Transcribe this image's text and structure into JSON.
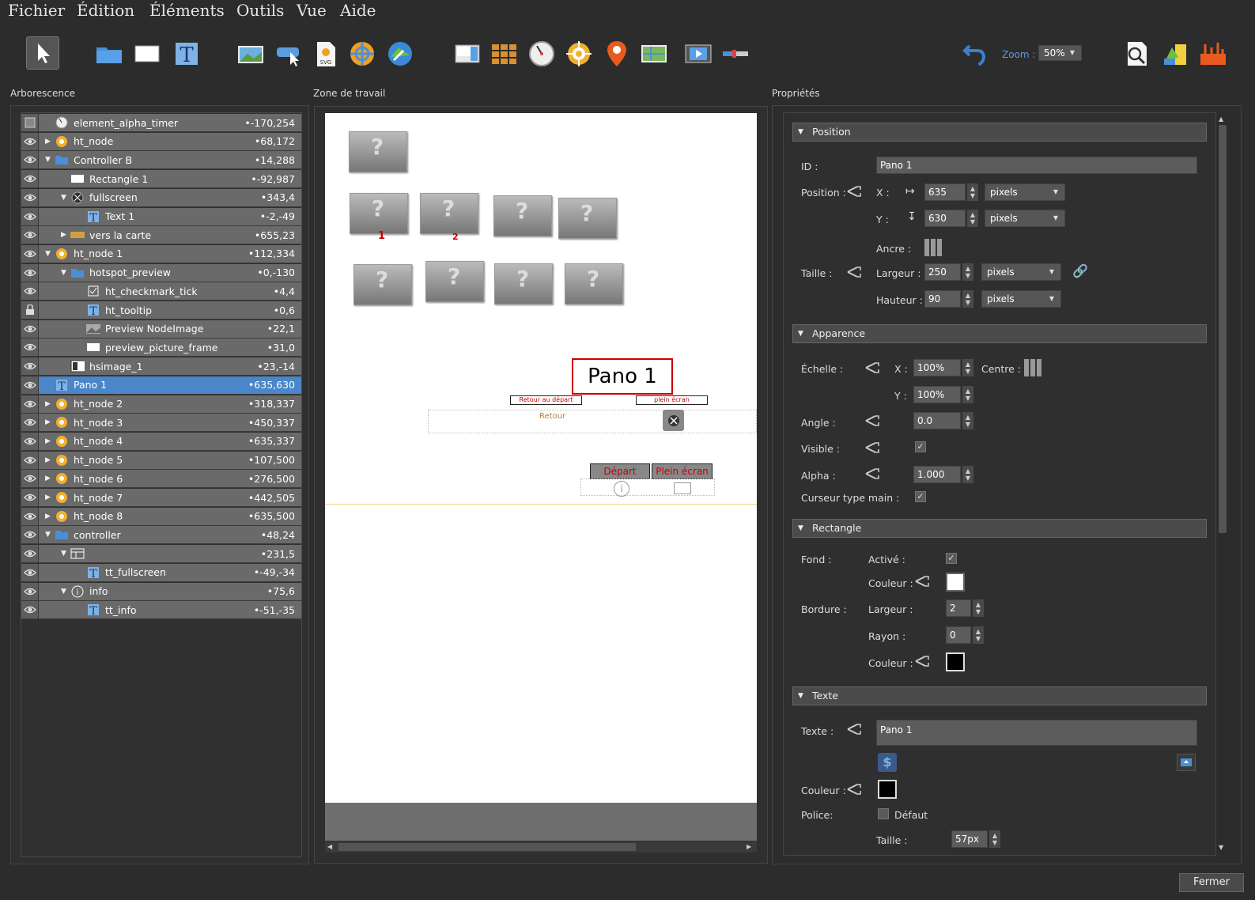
{
  "menu": [
    "Fichier",
    "Édition",
    "Éléments",
    "Outils",
    "Vue",
    "Aide"
  ],
  "toolbar": {
    "zoom_label": "Zoom :",
    "zoom_value": "50%"
  },
  "panels": {
    "tree": "Arborescence",
    "work": "Zone de travail",
    "props": "Propriétés"
  },
  "tree": [
    {
      "label": "element_alpha_timer",
      "val": "•-170,254",
      "indent": 0,
      "arrow": "",
      "icon": "timer-icon",
      "eye": false
    },
    {
      "label": "ht_node",
      "val": "•68,172",
      "indent": 0,
      "arrow": "▶",
      "icon": "node-icon",
      "eye": true
    },
    {
      "label": "Controller B",
      "val": "•14,288",
      "indent": 0,
      "arrow": "▼",
      "icon": "folder-icon",
      "eye": true
    },
    {
      "label": "Rectangle 1",
      "val": "•-92,987",
      "indent": 1,
      "arrow": "",
      "icon": "rectangle-icon",
      "eye": true
    },
    {
      "label": "fullscreen",
      "val": "•343,4",
      "indent": 1,
      "arrow": "▼",
      "icon": "fullscreen-icon",
      "eye": true
    },
    {
      "label": "Text 1",
      "val": "•-2,-49",
      "indent": 2,
      "arrow": "",
      "icon": "text-icon",
      "eye": true
    },
    {
      "label": "vers la carte",
      "val": "•655,23",
      "indent": 1,
      "arrow": "▶",
      "icon": "button-icon",
      "eye": true
    },
    {
      "label": "ht_node 1",
      "val": "•112,334",
      "indent": 0,
      "arrow": "▼",
      "icon": "node-icon",
      "eye": true
    },
    {
      "label": "hotspot_preview",
      "val": "•0,-130",
      "indent": 1,
      "arrow": "▼",
      "icon": "folder-icon",
      "eye": true
    },
    {
      "label": "ht_checkmark_tick",
      "val": "•4,4",
      "indent": 2,
      "arrow": "",
      "icon": "checkbox-icon",
      "eye": true
    },
    {
      "label": "ht_tooltip",
      "val": "•0,6",
      "indent": 2,
      "arrow": "",
      "icon": "text-icon",
      "eye": false,
      "lock": true
    },
    {
      "label": "Preview NodeImage",
      "val": "•22,1",
      "indent": 2,
      "arrow": "",
      "icon": "image-icon",
      "eye": true
    },
    {
      "label": "preview_picture_frame",
      "val": "•31,0",
      "indent": 2,
      "arrow": "",
      "icon": "rectangle-icon",
      "eye": true
    },
    {
      "label": "hsimage_1",
      "val": "•23,-14",
      "indent": 1,
      "arrow": "",
      "icon": "hsimage-icon",
      "eye": true
    },
    {
      "label": "Pano 1",
      "val": "•635,630",
      "indent": 0,
      "arrow": "",
      "icon": "text-icon",
      "eye": true,
      "sel": true
    },
    {
      "label": "ht_node 2",
      "val": "•318,337",
      "indent": 0,
      "arrow": "▶",
      "icon": "node-icon",
      "eye": true
    },
    {
      "label": "ht_node 3",
      "val": "•450,337",
      "indent": 0,
      "arrow": "▶",
      "icon": "node-icon",
      "eye": true
    },
    {
      "label": "ht_node 4",
      "val": "•635,337",
      "indent": 0,
      "arrow": "▶",
      "icon": "node-icon",
      "eye": true
    },
    {
      "label": "ht_node 5",
      "val": "•107,500",
      "indent": 0,
      "arrow": "▶",
      "icon": "node-icon",
      "eye": true
    },
    {
      "label": "ht_node 6",
      "val": "•276,500",
      "indent": 0,
      "arrow": "▶",
      "icon": "node-icon",
      "eye": true
    },
    {
      "label": "ht_node 7",
      "val": "•442,505",
      "indent": 0,
      "arrow": "▶",
      "icon": "node-icon",
      "eye": true
    },
    {
      "label": "ht_node 8",
      "val": "•635,500",
      "indent": 0,
      "arrow": "▶",
      "icon": "node-icon",
      "eye": true
    },
    {
      "label": "controller",
      "val": "•48,24",
      "indent": 0,
      "arrow": "▼",
      "icon": "folder-icon",
      "eye": true
    },
    {
      "label": "",
      "val": "•231,5",
      "indent": 1,
      "arrow": "▼",
      "icon": "window-icon",
      "eye": true
    },
    {
      "label": "tt_fullscreen",
      "val": "•-49,-34",
      "indent": 2,
      "arrow": "",
      "icon": "text-icon",
      "eye": true
    },
    {
      "label": "info",
      "val": "•75,6",
      "indent": 1,
      "arrow": "▼",
      "icon": "info-icon",
      "eye": true
    },
    {
      "label": "tt_info",
      "val": "•-51,-35",
      "indent": 2,
      "arrow": "",
      "icon": "text-icon",
      "eye": true
    }
  ],
  "canvas": {
    "pano_text": "Pano 1",
    "retour_depart": "Retour au départ",
    "plein_ecran_small": "plein écran",
    "retour": "Retour",
    "depart": "Départ",
    "plein_ecran": "Plein écran",
    "num1": "1",
    "num2": "2"
  },
  "props": {
    "sections": {
      "position": "Position",
      "appearance": "Apparence",
      "rectangle": "Rectangle",
      "text": "Texte"
    },
    "id_label": "ID :",
    "id_value": "Pano 1",
    "position_label": "Position :",
    "x_label": "X :",
    "x_value": "635",
    "x_unit": "pixels",
    "y_label": "Y :",
    "y_value": "630",
    "y_unit": "pixels",
    "anchor_label": "Ancre :",
    "size_label": "Taille :",
    "width_label": "Largeur :",
    "width_value": "250",
    "width_unit": "pixels",
    "height_label": "Hauteur :",
    "height_value": "90",
    "height_unit": "pixels",
    "scale_label": "Échelle :",
    "scale_x_label": "X :",
    "scale_x": "100%",
    "center_label": "Centre :",
    "scale_y_label": "Y :",
    "scale_y": "100%",
    "angle_label": "Angle :",
    "angle": "0.0",
    "visible_label": "Visible :",
    "alpha_label": "Alpha :",
    "alpha": "1.000",
    "cursor_label": "Curseur type main :",
    "fond_label": "Fond :",
    "active_label": "Activé :",
    "color_label": "Couleur :",
    "border_label": "Bordure :",
    "border_width_label": "Largeur :",
    "border_width": "2",
    "radius_label": "Rayon :",
    "radius": "0",
    "border_color_label": "Couleur :",
    "text_label": "Texte :",
    "text_value": "Pano 1",
    "text_color_label": "Couleur :",
    "font_label": "Police:",
    "font_default": "Défaut",
    "font_size_label": "Taille :",
    "font_size": "57px"
  },
  "close_button": "Fermer",
  "colors": {
    "selection": "#4a86c8",
    "accent_red": "#cc0000",
    "bg": "#2c2c2c"
  }
}
